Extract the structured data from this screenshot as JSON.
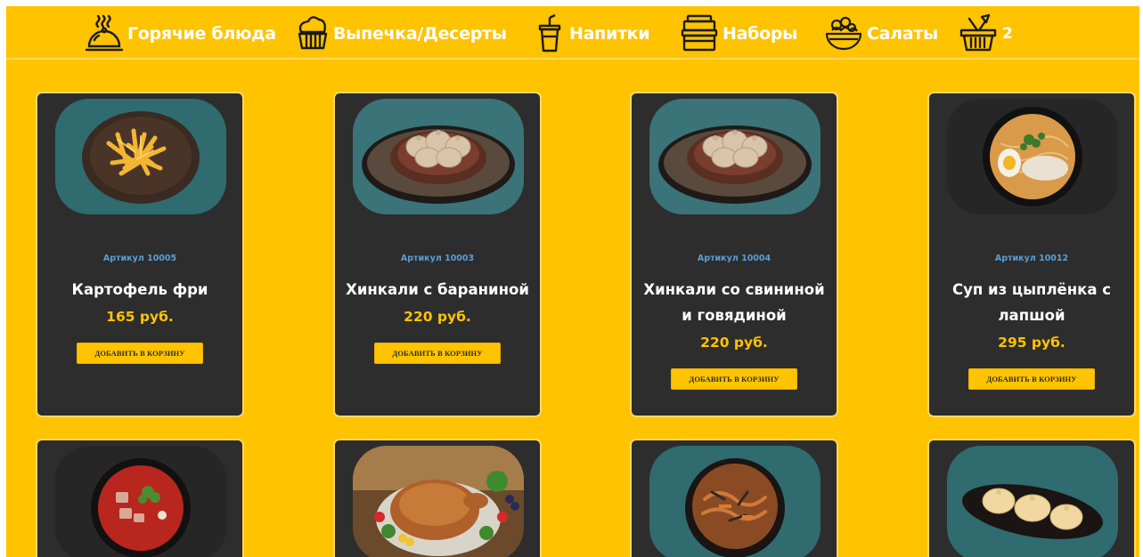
{
  "nav": {
    "items": [
      {
        "label": "Горячие блюда",
        "icon": "cloche-icon"
      },
      {
        "label": "Выпечка/Десерты",
        "icon": "cupcake-icon"
      },
      {
        "label": "Напитки",
        "icon": "drink-cup-icon"
      },
      {
        "label": "Наборы",
        "icon": "lunchbox-stack-icon"
      },
      {
        "label": "Салаты",
        "icon": "salad-bowl-icon"
      }
    ],
    "cart": {
      "icon": "basket-icon",
      "count": "2"
    }
  },
  "products": [
    {
      "sku": "Артикул 10005",
      "name": "Картофель фри",
      "price": "165 руб.",
      "button": "ДОБАВИТЬ В КОРЗИНУ"
    },
    {
      "sku": "Артикул 10003",
      "name": "Хинкали с бараниной",
      "price": "220 руб.",
      "button": "ДОБАВИТЬ В КОРЗИНУ"
    },
    {
      "sku": "Артикул 10004",
      "name": "Хинкали со свининой и говядиной",
      "price": "220 руб.",
      "button": "ДОБАВИТЬ В КОРЗИНУ"
    },
    {
      "sku": "Артикул 10012",
      "name": "Суп из цыплёнка с лапшой",
      "price": "295 руб.",
      "button": "ДОБАВИТЬ В КОРЗИНУ"
    }
  ],
  "colors": {
    "accent": "#ffc300",
    "card": "#2d2d2d",
    "sku": "#5a9fd6",
    "card_border": "#ffd864"
  }
}
